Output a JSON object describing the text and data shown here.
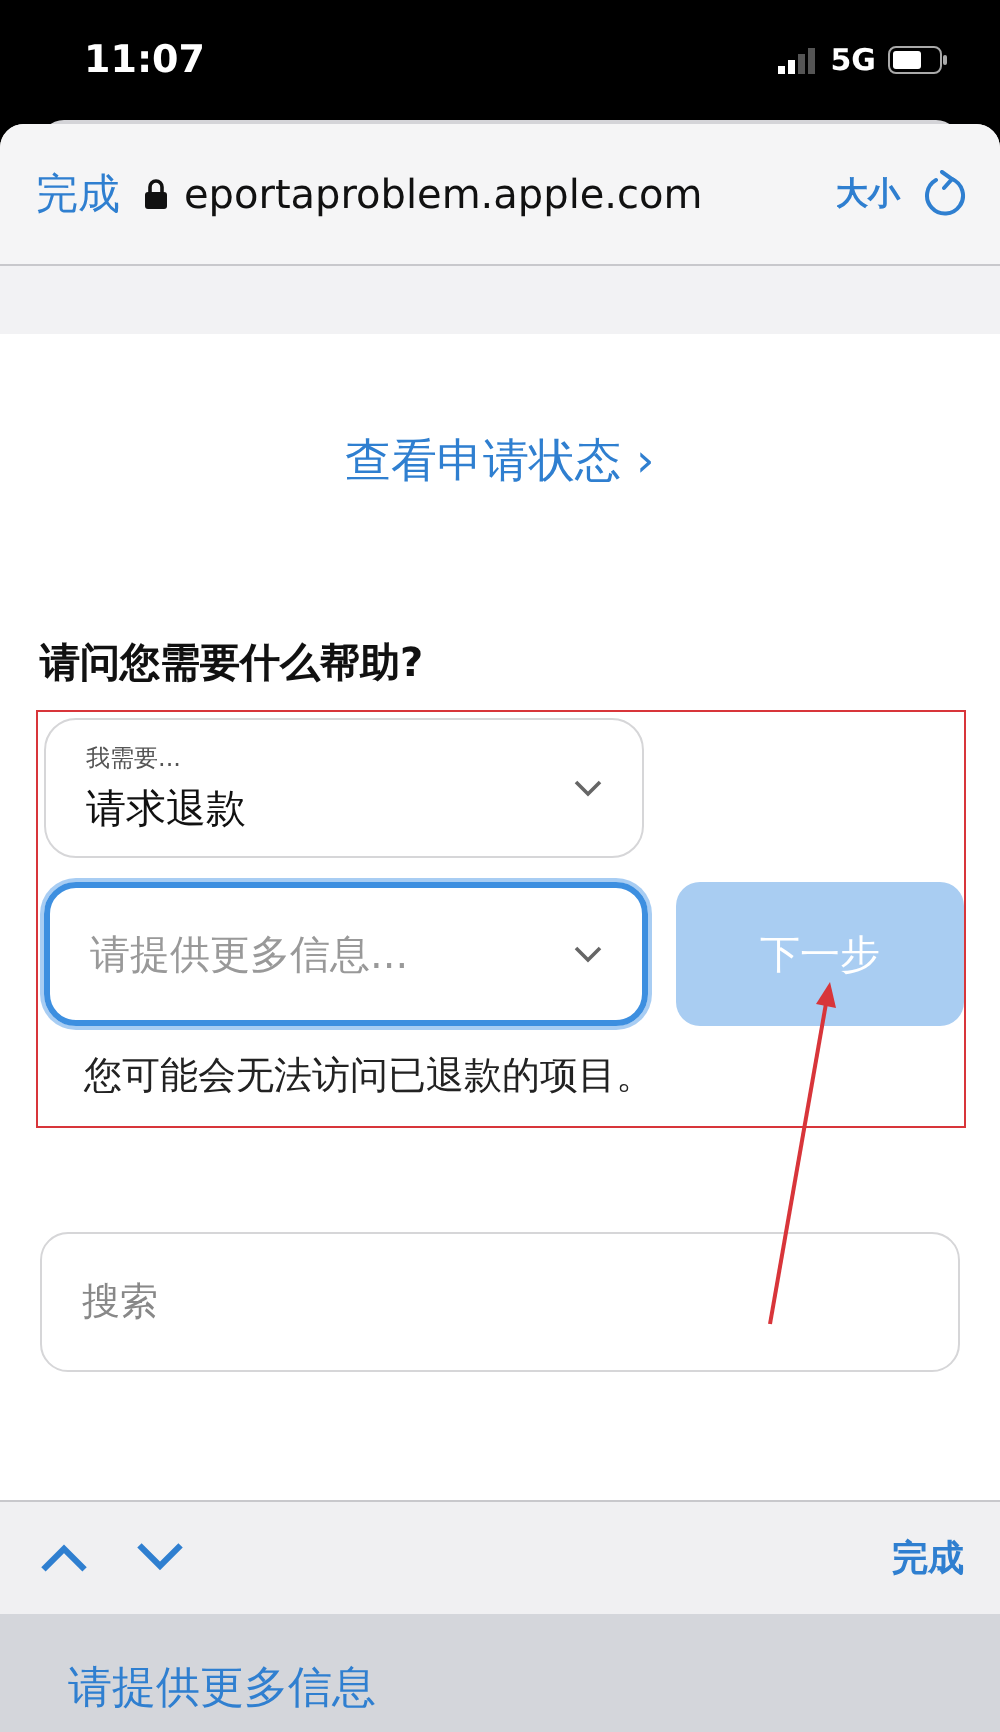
{
  "status_bar": {
    "time": "11:07",
    "network": "5G"
  },
  "browser": {
    "done": "完成",
    "url": "eportaproblem.apple.com",
    "text_size": "大小"
  },
  "page": {
    "status_link": "查看申请状态 ›",
    "heading": "请问您需要什么帮助?",
    "reason_select": {
      "label": "我需要...",
      "value": "请求退款"
    },
    "detail_select": {
      "placeholder": "请提供更多信息...",
      "focused": true
    },
    "next_button": {
      "label": "下一步",
      "disabled": true
    },
    "note": "您可能会无法访问已退款的项目。",
    "search": {
      "placeholder": "搜索"
    }
  },
  "keyboard_bar": {
    "done": "完成"
  },
  "picker": {
    "items": [
      "请提供更多信息"
    ]
  }
}
